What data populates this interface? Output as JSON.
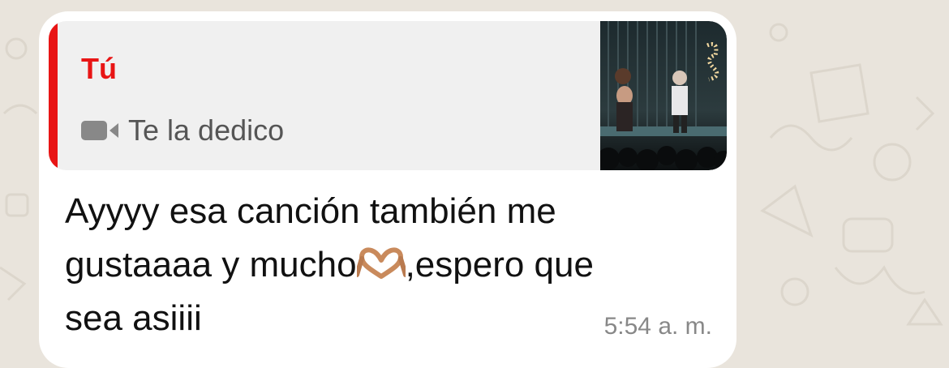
{
  "quote": {
    "author": "Tú",
    "text": "Te la dedico",
    "media_icon": "video-camera-icon",
    "thumbnail": "concert-stage-photo"
  },
  "message": {
    "line1": "Ayyyy esa canción también me",
    "line2_a": "gustaaaa y mucho",
    "emoji": "heart-hands-emoji",
    "line2_b": ",espero que",
    "line3": "sea asiiii"
  },
  "meta": {
    "time": "5:54",
    "period": "a. m."
  },
  "colors": {
    "accent": "#e81515",
    "bubble": "#ffffff",
    "quote_bg": "#f0f0f0",
    "chat_bg": "#e9e4dc"
  }
}
